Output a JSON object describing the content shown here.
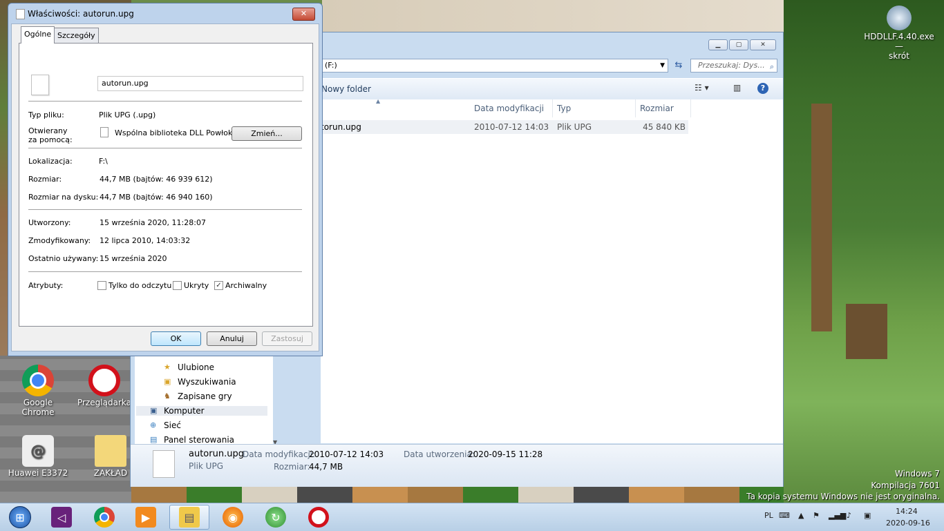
{
  "properties_dialog": {
    "title": "Właściwości: autorun.upg",
    "close": "✕",
    "tabs": [
      "Ogólne",
      "Szczegóły"
    ],
    "file_name": "autorun.upg",
    "rows": {
      "type_label": "Typ pliku:",
      "type_value": "Plik UPG (.upg)",
      "opens_label_1": "Otwierany",
      "opens_label_2": "za pomocą:",
      "opens_value": "Wspólna biblioteka DLL Powłoki sy",
      "change_button": "Zmień...",
      "location_label": "Lokalizacja:",
      "location_value": "F:\\",
      "size_label": "Rozmiar:",
      "size_value": "44,7 MB (bajtów: 46 939 612)",
      "size_on_disk_label": "Rozmiar na dysku:",
      "size_on_disk_value": "44,7 MB (bajtów: 46 940 160)",
      "created_label": "Utworzony:",
      "created_value": "15 września 2020, 11:28:07",
      "modified_label": "Zmodyfikowany:",
      "modified_value": "12 lipca 2010, 14:03:32",
      "accessed_label": "Ostatnio używany:",
      "accessed_value": "15 września 2020",
      "attributes_label": "Atrybuty:"
    },
    "attributes": [
      {
        "label": "Tylko do odczytu",
        "checked": false
      },
      {
        "label": "Ukryty",
        "checked": false
      },
      {
        "label": "Archiwalny",
        "checked": true
      }
    ],
    "buttons": {
      "ok": "OK",
      "cancel": "Anuluj",
      "apply": "Zastosuj"
    }
  },
  "explorer": {
    "address": "(F:)",
    "search_placeholder": "Przeszukaj: Dys...",
    "new_folder": "Nowy folder",
    "columns": {
      "date": "Data modyfikacji",
      "type": "Typ",
      "size": "Rozmiar"
    },
    "file_row": {
      "name": "torun.upg",
      "date": "2010-07-12 14:03",
      "type": "Plik UPG",
      "size": "45 840 KB"
    },
    "nav_items": [
      "Ulubione",
      "Wyszukiwania",
      "Zapisane gry",
      "Komputer",
      "Sieć",
      "Panel sterowania"
    ],
    "details": {
      "name": "autorun.upg",
      "type": "Plik UPG",
      "modified_label": "Data modyfikacji:",
      "modified_value": "2010-07-12 14:03",
      "created_label": "Data utworzenia:",
      "created_value": "2020-09-15 11:28",
      "size_label": "Rozmiar:",
      "size_value": "44,7 MB"
    }
  },
  "desktop_icons": {
    "chrome": "Google Chrome",
    "opera": "Przeglądarka",
    "huawei": "Huawei E3372",
    "folder": "ZAKŁAD",
    "hdd_1": "HDDLLF.4.40.exe —",
    "hdd_2": "skrót"
  },
  "watermark": [
    "Windows 7",
    "Kompilacja 7601",
    "Ta kopia systemu Windows nie jest oryginalna."
  ],
  "tray": {
    "lang": "PL",
    "time": "14:24",
    "date": "2020-09-16"
  }
}
